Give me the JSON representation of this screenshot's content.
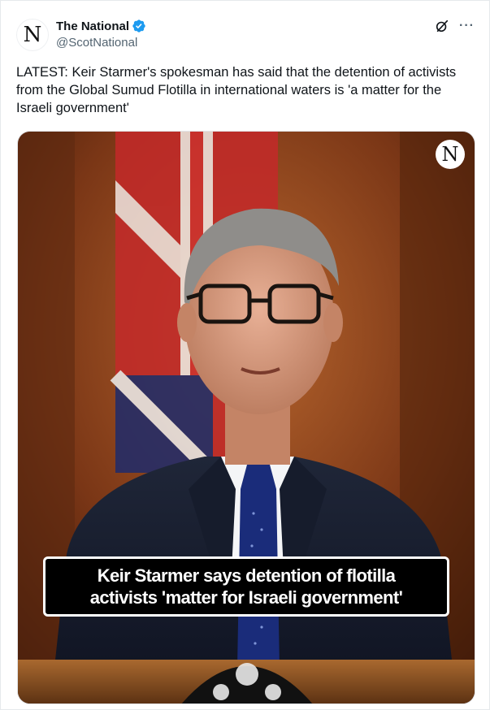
{
  "account": {
    "display_name": "The National",
    "handle": "@ScotNational",
    "avatar_letter": "N",
    "verified_color": "#1d9bf0"
  },
  "post": {
    "text": "LATEST: Keir Starmer's spokesman has said that the detention of activists from the Global Sumud Flotilla in international waters is 'a matter for the Israeli government'"
  },
  "media": {
    "watermark_letter": "N",
    "caption_line1": "Keir Starmer says detention of flotilla",
    "caption_line2": "activists 'matter for Israeli government'"
  },
  "icons": {
    "grok": "grok-icon",
    "more": "more-options-icon",
    "more_glyph": "···"
  }
}
